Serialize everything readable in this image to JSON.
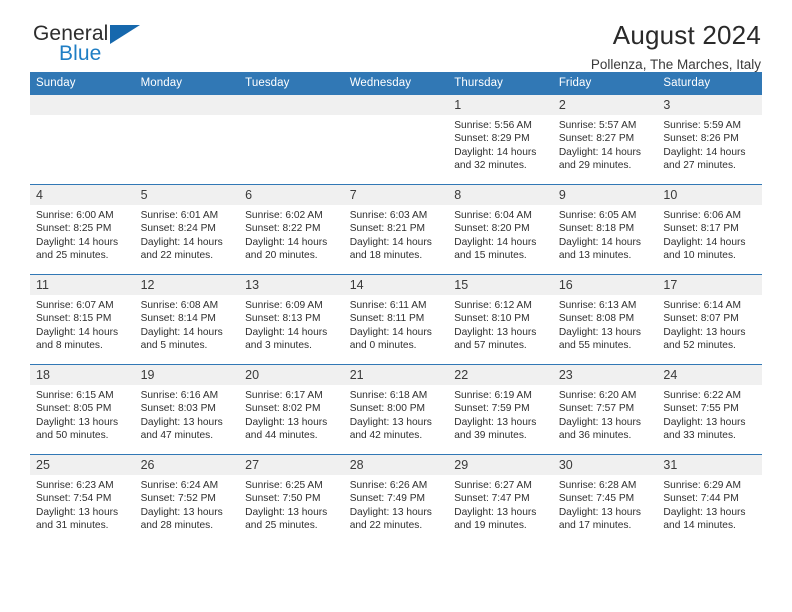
{
  "brand": {
    "name_top": "General",
    "name_bottom": "Blue",
    "accent_color": "#1668ad",
    "text_color": "#2d2d2d"
  },
  "header": {
    "title": "August 2024",
    "subtitle": "Pollenza, The Marches, Italy"
  },
  "calendar": {
    "header_bg": "#3178b5",
    "header_text": "#ffffff",
    "daynum_bg": "#f0f0f0",
    "weekday_headers": [
      "Sunday",
      "Monday",
      "Tuesday",
      "Wednesday",
      "Thursday",
      "Friday",
      "Saturday"
    ],
    "weeks": [
      [
        {
          "day": "",
          "sunrise": "",
          "sunset": "",
          "daylight": ""
        },
        {
          "day": "",
          "sunrise": "",
          "sunset": "",
          "daylight": ""
        },
        {
          "day": "",
          "sunrise": "",
          "sunset": "",
          "daylight": ""
        },
        {
          "day": "",
          "sunrise": "",
          "sunset": "",
          "daylight": ""
        },
        {
          "day": "1",
          "sunrise": "Sunrise: 5:56 AM",
          "sunset": "Sunset: 8:29 PM",
          "daylight": "Daylight: 14 hours and 32 minutes."
        },
        {
          "day": "2",
          "sunrise": "Sunrise: 5:57 AM",
          "sunset": "Sunset: 8:27 PM",
          "daylight": "Daylight: 14 hours and 29 minutes."
        },
        {
          "day": "3",
          "sunrise": "Sunrise: 5:59 AM",
          "sunset": "Sunset: 8:26 PM",
          "daylight": "Daylight: 14 hours and 27 minutes."
        }
      ],
      [
        {
          "day": "4",
          "sunrise": "Sunrise: 6:00 AM",
          "sunset": "Sunset: 8:25 PM",
          "daylight": "Daylight: 14 hours and 25 minutes."
        },
        {
          "day": "5",
          "sunrise": "Sunrise: 6:01 AM",
          "sunset": "Sunset: 8:24 PM",
          "daylight": "Daylight: 14 hours and 22 minutes."
        },
        {
          "day": "6",
          "sunrise": "Sunrise: 6:02 AM",
          "sunset": "Sunset: 8:22 PM",
          "daylight": "Daylight: 14 hours and 20 minutes."
        },
        {
          "day": "7",
          "sunrise": "Sunrise: 6:03 AM",
          "sunset": "Sunset: 8:21 PM",
          "daylight": "Daylight: 14 hours and 18 minutes."
        },
        {
          "day": "8",
          "sunrise": "Sunrise: 6:04 AM",
          "sunset": "Sunset: 8:20 PM",
          "daylight": "Daylight: 14 hours and 15 minutes."
        },
        {
          "day": "9",
          "sunrise": "Sunrise: 6:05 AM",
          "sunset": "Sunset: 8:18 PM",
          "daylight": "Daylight: 14 hours and 13 minutes."
        },
        {
          "day": "10",
          "sunrise": "Sunrise: 6:06 AM",
          "sunset": "Sunset: 8:17 PM",
          "daylight": "Daylight: 14 hours and 10 minutes."
        }
      ],
      [
        {
          "day": "11",
          "sunrise": "Sunrise: 6:07 AM",
          "sunset": "Sunset: 8:15 PM",
          "daylight": "Daylight: 14 hours and 8 minutes."
        },
        {
          "day": "12",
          "sunrise": "Sunrise: 6:08 AM",
          "sunset": "Sunset: 8:14 PM",
          "daylight": "Daylight: 14 hours and 5 minutes."
        },
        {
          "day": "13",
          "sunrise": "Sunrise: 6:09 AM",
          "sunset": "Sunset: 8:13 PM",
          "daylight": "Daylight: 14 hours and 3 minutes."
        },
        {
          "day": "14",
          "sunrise": "Sunrise: 6:11 AM",
          "sunset": "Sunset: 8:11 PM",
          "daylight": "Daylight: 14 hours and 0 minutes."
        },
        {
          "day": "15",
          "sunrise": "Sunrise: 6:12 AM",
          "sunset": "Sunset: 8:10 PM",
          "daylight": "Daylight: 13 hours and 57 minutes."
        },
        {
          "day": "16",
          "sunrise": "Sunrise: 6:13 AM",
          "sunset": "Sunset: 8:08 PM",
          "daylight": "Daylight: 13 hours and 55 minutes."
        },
        {
          "day": "17",
          "sunrise": "Sunrise: 6:14 AM",
          "sunset": "Sunset: 8:07 PM",
          "daylight": "Daylight: 13 hours and 52 minutes."
        }
      ],
      [
        {
          "day": "18",
          "sunrise": "Sunrise: 6:15 AM",
          "sunset": "Sunset: 8:05 PM",
          "daylight": "Daylight: 13 hours and 50 minutes."
        },
        {
          "day": "19",
          "sunrise": "Sunrise: 6:16 AM",
          "sunset": "Sunset: 8:03 PM",
          "daylight": "Daylight: 13 hours and 47 minutes."
        },
        {
          "day": "20",
          "sunrise": "Sunrise: 6:17 AM",
          "sunset": "Sunset: 8:02 PM",
          "daylight": "Daylight: 13 hours and 44 minutes."
        },
        {
          "day": "21",
          "sunrise": "Sunrise: 6:18 AM",
          "sunset": "Sunset: 8:00 PM",
          "daylight": "Daylight: 13 hours and 42 minutes."
        },
        {
          "day": "22",
          "sunrise": "Sunrise: 6:19 AM",
          "sunset": "Sunset: 7:59 PM",
          "daylight": "Daylight: 13 hours and 39 minutes."
        },
        {
          "day": "23",
          "sunrise": "Sunrise: 6:20 AM",
          "sunset": "Sunset: 7:57 PM",
          "daylight": "Daylight: 13 hours and 36 minutes."
        },
        {
          "day": "24",
          "sunrise": "Sunrise: 6:22 AM",
          "sunset": "Sunset: 7:55 PM",
          "daylight": "Daylight: 13 hours and 33 minutes."
        }
      ],
      [
        {
          "day": "25",
          "sunrise": "Sunrise: 6:23 AM",
          "sunset": "Sunset: 7:54 PM",
          "daylight": "Daylight: 13 hours and 31 minutes."
        },
        {
          "day": "26",
          "sunrise": "Sunrise: 6:24 AM",
          "sunset": "Sunset: 7:52 PM",
          "daylight": "Daylight: 13 hours and 28 minutes."
        },
        {
          "day": "27",
          "sunrise": "Sunrise: 6:25 AM",
          "sunset": "Sunset: 7:50 PM",
          "daylight": "Daylight: 13 hours and 25 minutes."
        },
        {
          "day": "28",
          "sunrise": "Sunrise: 6:26 AM",
          "sunset": "Sunset: 7:49 PM",
          "daylight": "Daylight: 13 hours and 22 minutes."
        },
        {
          "day": "29",
          "sunrise": "Sunrise: 6:27 AM",
          "sunset": "Sunset: 7:47 PM",
          "daylight": "Daylight: 13 hours and 19 minutes."
        },
        {
          "day": "30",
          "sunrise": "Sunrise: 6:28 AM",
          "sunset": "Sunset: 7:45 PM",
          "daylight": "Daylight: 13 hours and 17 minutes."
        },
        {
          "day": "31",
          "sunrise": "Sunrise: 6:29 AM",
          "sunset": "Sunset: 7:44 PM",
          "daylight": "Daylight: 13 hours and 14 minutes."
        }
      ]
    ]
  }
}
